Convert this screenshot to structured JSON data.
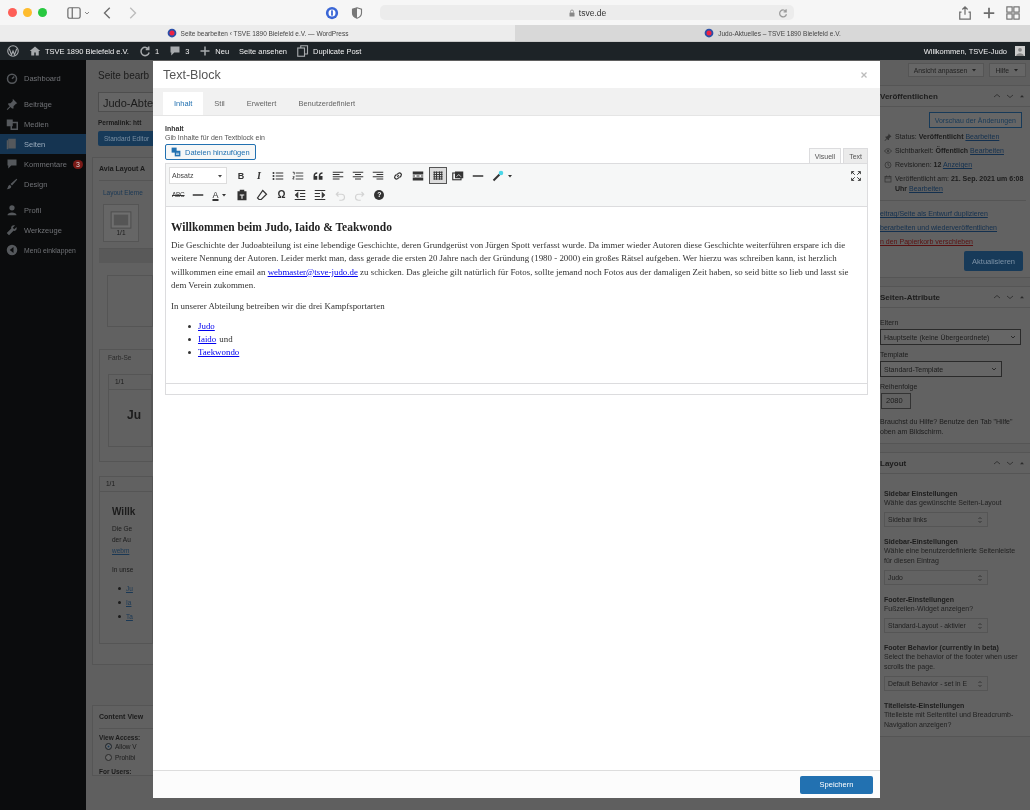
{
  "browser": {
    "address": "tsve.de",
    "tabs": [
      {
        "title": "Seite bearbeiten ‹ TSVE 1890 Bielefeld e.V. — WordPress",
        "selected": true
      },
      {
        "title": "Judo-Aktuelles – TSVE 1890 Bielefeld e.V.",
        "selected": false
      }
    ]
  },
  "admin_bar": {
    "site": "TSVE 1890 Bielefeld e.V.",
    "updates": "1",
    "comments": "3",
    "new": "Neu",
    "view": "Seite ansehen",
    "duplicate": "Duplicate Post",
    "greeting": "Willkommen, TSVE-Judo"
  },
  "sidebar": {
    "items": [
      {
        "kind": "dashboard",
        "label": "Dashboard",
        "selected": false
      },
      {
        "kind": "pin",
        "label": "Beiträge",
        "selected": false
      },
      {
        "kind": "media",
        "label": "Medien",
        "selected": false
      },
      {
        "kind": "pages",
        "label": "Seiten",
        "selected": true
      },
      {
        "kind": "comment",
        "label": "Kommentare",
        "selected": false,
        "badge": "3"
      },
      {
        "kind": "brush",
        "label": "Design",
        "selected": false
      },
      {
        "kind": "user",
        "label": "Profil",
        "selected": false
      },
      {
        "kind": "wrench",
        "label": "Werkzeuge",
        "selected": false
      }
    ],
    "collapse": "Menü einklappen"
  },
  "page": {
    "title": "Seite bearb",
    "title_field": "Judo-Abte",
    "permalink": "Permalink: htt",
    "editor_button": "Standard Editor",
    "builder": {
      "title": "Avia Layout A",
      "link": "Layout Eleme",
      "element_label": "1/1",
      "section": "Farb-Se",
      "cell_1": "1/1",
      "cell_1_text": "Ju",
      "cell_2": "1/1",
      "cell_2_heading": "Willk",
      "cell_2_lines": [
        "Die Ge",
        "der Au"
      ],
      "cell_2_link": "webm",
      "cell_2_para": "In unse",
      "cell_2_list": [
        "Ju",
        "Ia",
        "Ta"
      ]
    },
    "content_view": {
      "title": "Content View",
      "access_label": "View Access:",
      "options": [
        {
          "label": "Allow V",
          "selected": true
        },
        {
          "label": "Prohibi",
          "selected": false
        }
      ],
      "users_label": "For Users:"
    }
  },
  "modal": {
    "title": "Text-Block",
    "tabs": [
      {
        "label": "Inhalt",
        "selected": true
      },
      {
        "label": "Stil",
        "selected": false
      },
      {
        "label": "Erweitert",
        "selected": false
      },
      {
        "label": "Benutzerdefiniert",
        "selected": false
      }
    ],
    "field_label": "Inhalt",
    "field_hint": "Gib Inhalte für den Textblock ein",
    "add_media": "Dateien hinzufügen",
    "mode_tabs": [
      {
        "label": "Visuell",
        "selected": true
      },
      {
        "label": "Text",
        "selected": false
      }
    ],
    "toolbar": [
      [
        {
          "kind": "format",
          "label": "Absatz",
          "pressed": false,
          "disabled": false
        },
        {
          "kind": "bold",
          "label": "B",
          "pressed": false,
          "disabled": false
        },
        {
          "kind": "italic",
          "label": "I",
          "pressed": false,
          "disabled": false
        },
        {
          "kind": "bullist",
          "pressed": false,
          "disabled": false
        },
        {
          "kind": "numlist",
          "pressed": false,
          "disabled": false
        },
        {
          "kind": "quote",
          "pressed": false,
          "disabled": false
        },
        {
          "kind": "alignleft",
          "pressed": false,
          "disabled": false
        },
        {
          "kind": "aligncenter",
          "pressed": false,
          "disabled": false
        },
        {
          "kind": "alignright",
          "pressed": false,
          "disabled": false
        },
        {
          "kind": "link",
          "pressed": false,
          "disabled": false
        },
        {
          "kind": "more",
          "pressed": false,
          "disabled": false
        },
        {
          "kind": "toolbar",
          "pressed": true,
          "disabled": false
        },
        {
          "kind": "media",
          "pressed": false,
          "disabled": false
        },
        {
          "kind": "hr",
          "pressed": false,
          "disabled": false
        },
        {
          "kind": "wand",
          "pressed": false,
          "disabled": false
        },
        {
          "kind": "fullscreen",
          "pressed": false,
          "disabled": false
        }
      ],
      [
        {
          "kind": "strike",
          "label": "ABC",
          "pressed": false,
          "disabled": false
        },
        {
          "kind": "hr",
          "pressed": false,
          "disabled": false
        },
        {
          "kind": "textcolor",
          "label": "A",
          "pressed": false,
          "disabled": false
        },
        {
          "kind": "paste",
          "pressed": false,
          "disabled": false
        },
        {
          "kind": "eraser",
          "pressed": false,
          "disabled": false
        },
        {
          "kind": "charmap",
          "label": "Ω",
          "pressed": false,
          "disabled": false
        },
        {
          "kind": "outdent",
          "pressed": false,
          "disabled": false
        },
        {
          "kind": "indent",
          "pressed": false,
          "disabled": false
        },
        {
          "kind": "undo",
          "pressed": false,
          "disabled": true
        },
        {
          "kind": "redo",
          "pressed": false,
          "disabled": true
        },
        {
          "kind": "help",
          "label": "?",
          "pressed": false,
          "disabled": false
        }
      ]
    ],
    "content": {
      "heading": "Willkommen beim Judo, Iaido & Teakwondo",
      "paragraphs": [
        {
          "text": "Die Geschichte der Judoabteilung ist eine lebendige Geschichte, deren Grundgerüst von Jürgen Spott verfasst wurde. Da immer wieder Autoren diese Geschichte weiterführen erspare ich die weitere Nennung der Autoren. Leider merkt man, dass gerade die ersten 20 Jahre nach der Gründung (1980 - 2000) ein großes Rätsel aufgeben. Wer hierzu was schreiben kann, ist herzlich willkommen eine email an",
          "link": "webmaster@tsve-judo.de",
          "after": "zu schicken. Das gleiche gilt natürlich für Fotos, sollte jemand noch Fotos aus der damaligen Zeit haben, so seid bitte so lieb und lasst sie dem Verein zukommen."
        },
        {
          "text": "In unserer Abteilung betreiben wir die drei Kampfsportarten"
        }
      ],
      "list": [
        {
          "link": "Judo"
        },
        {
          "link": "Iaido",
          "after": "und"
        },
        {
          "link": "Taekwondo"
        }
      ]
    },
    "save": "Speichern"
  },
  "right": {
    "screen_options": "Ansicht anpassen",
    "help": "Hilfe",
    "publish": {
      "title": "Veröffentlichen",
      "preview": "Vorschau der Änderungen",
      "meta": [
        {
          "kind": "pin",
          "text": "Status: **Veröffentlicht**",
          "link": "Bearbeiten"
        },
        {
          "kind": "eye",
          "text": "Sichtbarkeit: **Öffentlich**",
          "link": "Bearbeiten"
        },
        {
          "kind": "clock",
          "text": "Revisionen: **12**",
          "link": "Anzeigen"
        },
        {
          "kind": "calendar",
          "text": "Veröffentlicht am: **21. Sep. 2021 um 6:08 Uhr**",
          "link": "Bearbeiten"
        }
      ],
      "actions": [
        {
          "kind": "link",
          "text": "eitrag/Seite als Entwurf duplizieren"
        },
        {
          "kind": "link",
          "text": "berarbeiten und wiederveröffentlichen"
        },
        {
          "kind": "delete",
          "text": "n den Papierkorb verschieben"
        }
      ],
      "update": "Aktualisieren"
    },
    "attributes": {
      "title": "Seiten-Attribute",
      "parent_label": "Eltern",
      "parent": "Hauptseite (keine Übergeordnete)",
      "template_label": "Template",
      "template": "Standard-Template",
      "order_label": "Reihenfolge",
      "order": "2080",
      "help": "Brauchst du Hilfe? Benutze den Tab \"Hilfe\" oben am Bildschirm."
    },
    "layout": {
      "title": "Layout",
      "settings": [
        {
          "title": "Sidebar Einstellungen",
          "description": "Wähle das gewünschte Seiten-Layout",
          "value": "Sidebar links"
        },
        {
          "title": "Sidebar-Einstellungen",
          "description": "Wähle eine benutzerdefinierte Seitenleiste für diesen Eintrag",
          "value": "Judo"
        },
        {
          "title": "Footer-Einstellungen",
          "description": "Fußzeilen-Widget anzeigen?",
          "value": "Standard-Layout - aktivier"
        },
        {
          "title": "Footer Behavior (currently in beta)",
          "description": "Select the behavior of the footer when user scrolls the page.",
          "value": "Default Behavior - set in E"
        },
        {
          "title": "Titelleiste-Einstellungen",
          "description": "Titelleiste mit Seitentitel und Breadcrumb-Navigation anzeigen?"
        }
      ]
    }
  }
}
